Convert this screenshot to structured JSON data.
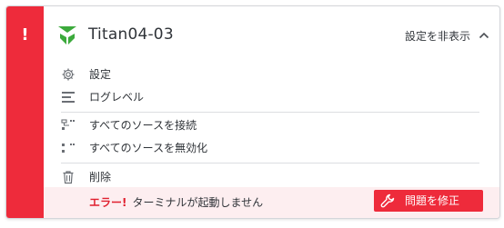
{
  "status": {
    "icon": "exclamation-icon",
    "mark": "!",
    "color": "#ee2b3b"
  },
  "header": {
    "logo_icon": "titan-logo-icon",
    "title": "Titan04-03",
    "hide_settings_label": "設定を非表示",
    "hide_settings_icon": "chevron-up-icon"
  },
  "menu": {
    "settings": {
      "label": "設定",
      "icon": "gear-icon"
    },
    "log_level": {
      "label": "ログレベル",
      "icon": "log-level-icon"
    },
    "connect_all": {
      "label": "すべてのソースを接続",
      "icon": "connect-sources-icon"
    },
    "disable_all": {
      "label": "すべてのソースを無効化",
      "icon": "disable-sources-icon"
    },
    "delete": {
      "label": "削除",
      "icon": "trash-icon"
    }
  },
  "error": {
    "label": "エラー!",
    "message": "ターミナルが起動しません",
    "fix_button_label": "問題を修正",
    "fix_button_icon": "wrench-icon"
  },
  "colors": {
    "accent_red": "#ee2b3b",
    "logo_green": "#3caa3c",
    "error_background": "#fdeef0"
  }
}
